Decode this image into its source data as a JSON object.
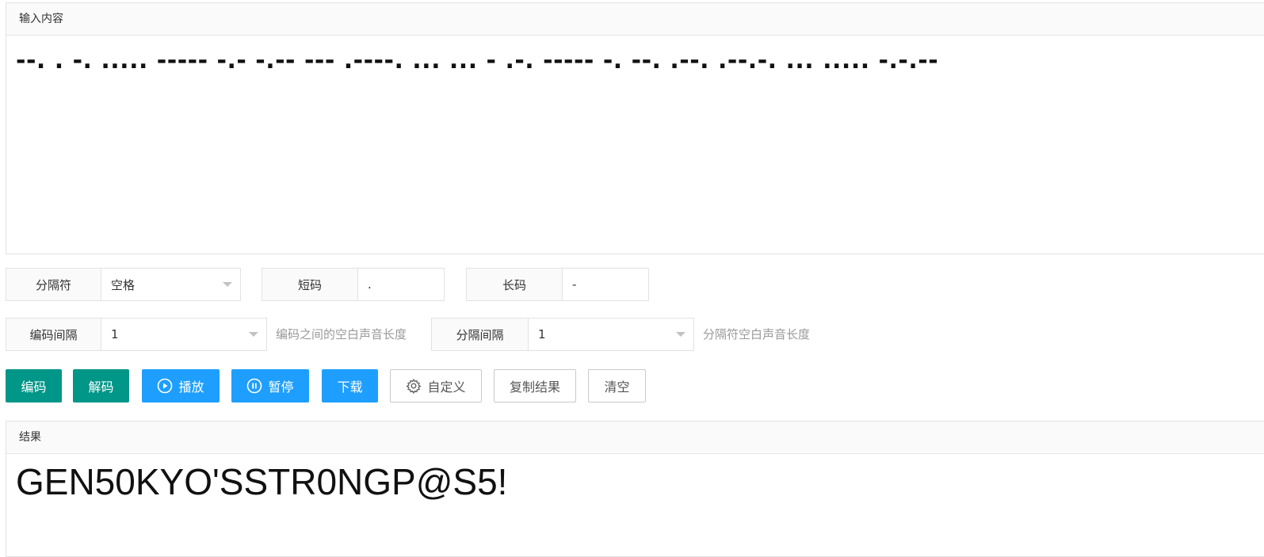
{
  "input": {
    "header": "输入内容",
    "value": "--. . -. ..... ----- -.- -.-- --- .----. ... ... - .-. ----- -. --. .--. .--.-. ... ..... -.-.--"
  },
  "options": {
    "separator": {
      "label": "分隔符",
      "value": "空格"
    },
    "short_code": {
      "label": "短码",
      "value": "."
    },
    "long_code": {
      "label": "长码",
      "value": "-"
    },
    "code_interval": {
      "label": "编码间隔",
      "value": "1",
      "hint": "编码之间的空白声音长度"
    },
    "separator_interval": {
      "label": "分隔间隔",
      "value": "1",
      "hint": "分隔符空白声音长度"
    }
  },
  "buttons": {
    "encode": "编码",
    "decode": "解码",
    "play": "播放",
    "pause": "暂停",
    "download": "下载",
    "customize": "自定义",
    "copy_result": "复制结果",
    "clear": "清空"
  },
  "result": {
    "header": "结果",
    "value": "GEN50KYO'SSTR0NGP@S5!"
  },
  "colors": {
    "primary_green": "#009688",
    "primary_blue": "#1e9fff"
  }
}
